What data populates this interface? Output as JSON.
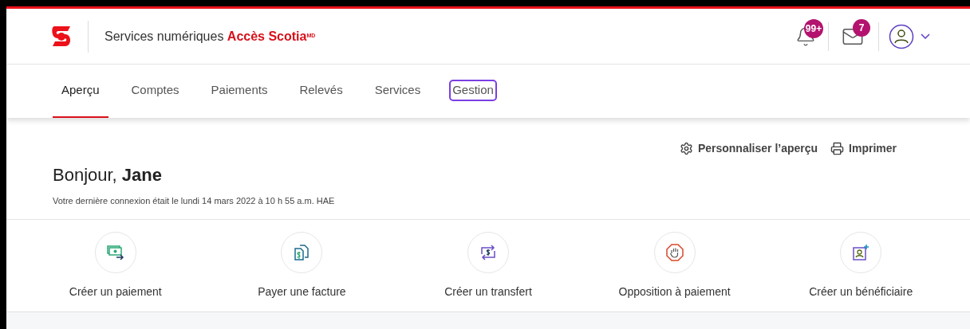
{
  "header": {
    "brand_prefix": "Services numériques ",
    "brand_name": "Accès Scotia",
    "brand_mark": "MD",
    "notifications_badge": "99+",
    "messages_badge": "7"
  },
  "tabs": [
    {
      "label": "Aperçu",
      "selected": true,
      "focused": false
    },
    {
      "label": "Comptes",
      "selected": false,
      "focused": false
    },
    {
      "label": "Paiements",
      "selected": false,
      "focused": false
    },
    {
      "label": "Relevés",
      "selected": false,
      "focused": false
    },
    {
      "label": "Services",
      "selected": false,
      "focused": false
    },
    {
      "label": "Gestion",
      "selected": false,
      "focused": true
    }
  ],
  "actions": [
    {
      "kind": "customize",
      "label": "Personnaliser l’aperçu"
    },
    {
      "kind": "print",
      "label": "Imprimer"
    }
  ],
  "greeting": {
    "text": "Bonjour, **Jane**",
    "last_login": "Votre dernière connexion était le lundi 14 mars 2022 à 10 h 55 a.m. HAE"
  },
  "quick_actions": [
    {
      "kind": "payment",
      "label": "Créer un paiement"
    },
    {
      "kind": "bill",
      "label": "Payer une facture"
    },
    {
      "kind": "transfer",
      "label": "Créer un transfert"
    },
    {
      "kind": "stop",
      "label": "Opposition à paiement"
    },
    {
      "kind": "payee",
      "label": "Créer un bénéficiaire"
    }
  ]
}
